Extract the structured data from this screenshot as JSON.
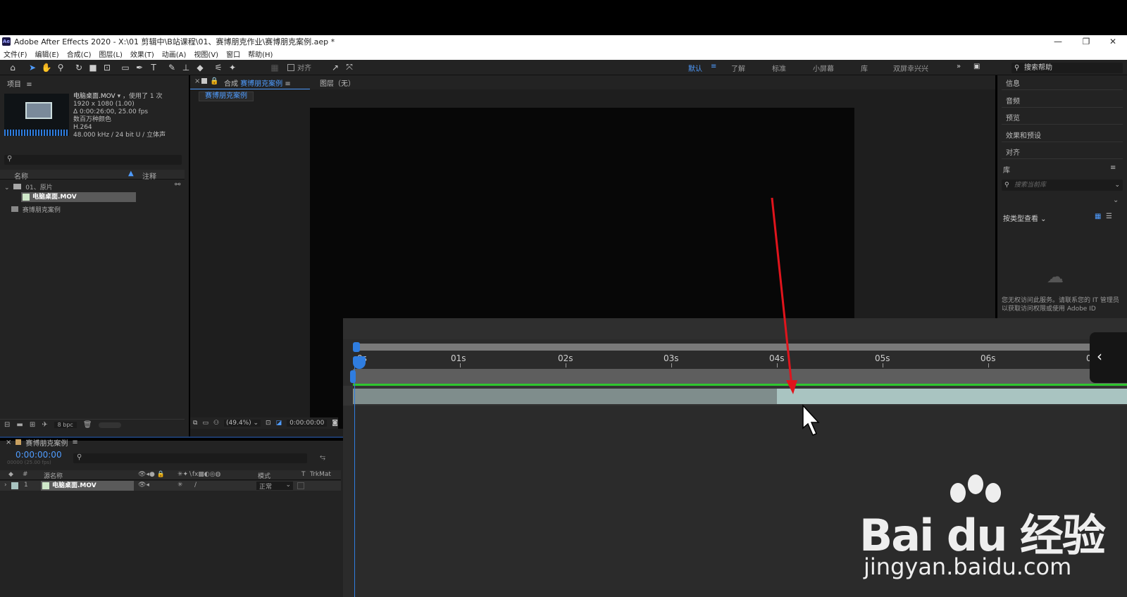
{
  "window": {
    "title": "Adobe After Effects 2020 - X:\\01 剪辑中\\B站课程\\01、赛博朋克作业\\赛博朋克案例.aep *",
    "app_icon": "Ae",
    "minimize": "—",
    "restore": "❐",
    "close": "✕"
  },
  "menu": [
    "文件(F)",
    "编辑(E)",
    "合成(C)",
    "图层(L)",
    "效果(T)",
    "动画(A)",
    "视图(V)",
    "窗口",
    "帮助(H)"
  ],
  "toolbar": {
    "align_label": "对齐",
    "workspaces": [
      "默认",
      "了解",
      "标准",
      "小屏幕",
      "库",
      "双屏幸兴兴"
    ],
    "active_workspace": "默认",
    "help_search_placeholder": "搜索帮助"
  },
  "project": {
    "title": "项目",
    "file_name": "电脑桌面.MOV",
    "usage": "，使用了 1 次",
    "resolution": "1920 x 1080 (1.00)",
    "duration": "Δ 0:00:26:00, 25.00 fps",
    "colors": "数百万种颜色",
    "codec": "H.264",
    "audio": "48.000 kHz / 24 bit U / 立体声",
    "col_name": "名称",
    "col_comment": "注释",
    "folder": "01、原片",
    "item_file": "电脑桌面.MOV",
    "item_comp": "赛博朋克案例",
    "bpc": "8 bpc"
  },
  "comp_panel": {
    "tab_prefix": "合成",
    "tab_name": "赛博朋克案例",
    "layer_tab": "图层（无）",
    "sub_tab": "赛博朋克案例",
    "zoom": "(49.4%)",
    "timecode": "0:00:00:00"
  },
  "right_panel": {
    "items": [
      "信息",
      "音频",
      "预览",
      "效果和预设",
      "对齐",
      "库"
    ],
    "library_search_placeholder": "搜索当前库",
    "view_by": "按类型查看",
    "notice": "您无权访问此服务。请联系您的 IT 管理员以获取访问权限或使用 Adobe ID"
  },
  "timeline": {
    "tab_name": "赛博朋克案例",
    "timecode": "0:00:00:00",
    "fps": "00000 (25.00 fps)",
    "col_source": "源名称",
    "col_mode": "模式",
    "col_t": "T",
    "col_trkmat": "TrkMat",
    "layer_num": "1",
    "layer_name": "电脑桌面.MOV",
    "layer_mode": "正常",
    "ruler": [
      "0s",
      "01s",
      "02s",
      "03s",
      "04s",
      "05s",
      "06s",
      "0"
    ]
  },
  "watermark": {
    "brand": "Bai du 经验",
    "url": "jingyan.baidu.com"
  },
  "colors": {
    "accent": "#4f9cff",
    "work_area": "#2fc62f",
    "annotation_arrow": "#e0141c",
    "layer_bar": "#7f8d8c",
    "layer_bar_light": "#a9c4c1"
  }
}
